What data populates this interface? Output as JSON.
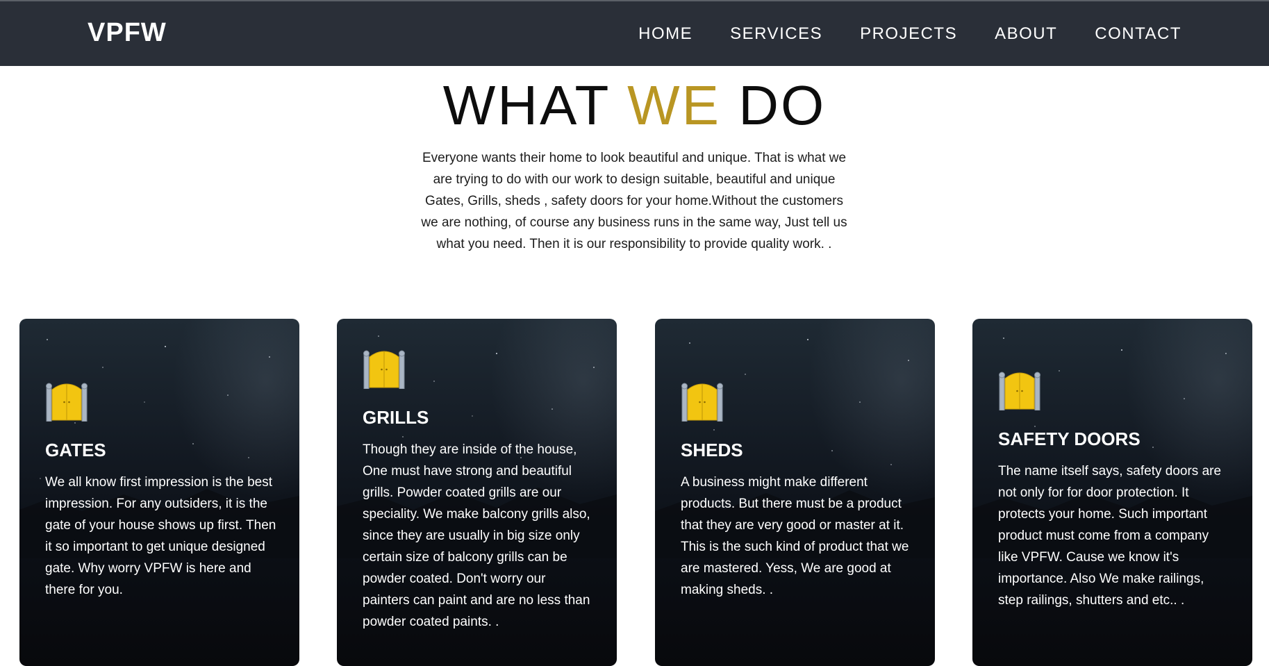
{
  "navbar": {
    "brand": "VPFW",
    "links": [
      "HOME",
      "SERVICES",
      "PROJECTS",
      "ABOUT",
      "CONTACT"
    ]
  },
  "section": {
    "title_part1": "WHAT ",
    "title_accent": "WE",
    "title_part2": " DO",
    "intro": "Everyone wants their home to look beautiful and unique. That is what we are trying to do with our work to design suitable, beautiful and unique Gates, Grills, sheds , safety doors for your home.Without the customers we are nothing, of course any business runs in the same way, Just tell us what you need. Then it is our responsibility to provide quality work. ."
  },
  "cards": [
    {
      "icon": "gate-icon",
      "title": "GATES",
      "text": "We all know first impression is the best impression. For any outsiders, it is the gate of your house shows up first. Then it so important to get unique designed gate. Why worry VPFW is here and there for you."
    },
    {
      "icon": "gate-icon",
      "title": "GRILLS",
      "text": "Though they are inside of the house, One must have strong and beautiful grills. Powder coated grills are our speciality. We make balcony grills also, since they are usually in big size only certain size of balcony grills can be powder coated. Don't worry our painters can paint and are no less than powder coated paints. ."
    },
    {
      "icon": "gate-icon",
      "title": "SHEDS",
      "text": "A business might make different products. But there must be a product that they are very good or master at it. This is the such kind of product that we are mastered. Yess, We are good at making sheds. ."
    },
    {
      "icon": "gate-icon",
      "title": "SAFETY DOORS",
      "text": "The name itself says, safety doors are not only for for door protection. It protects your home. Such important product must come from a company like VPFW. Cause we know it's importance. Also We make railings, step railings, shutters and etc.. ."
    }
  ],
  "colors": {
    "navbar_bg": "#2a2f38",
    "accent": "#b99623",
    "gate_yellow": "#f2c511"
  }
}
